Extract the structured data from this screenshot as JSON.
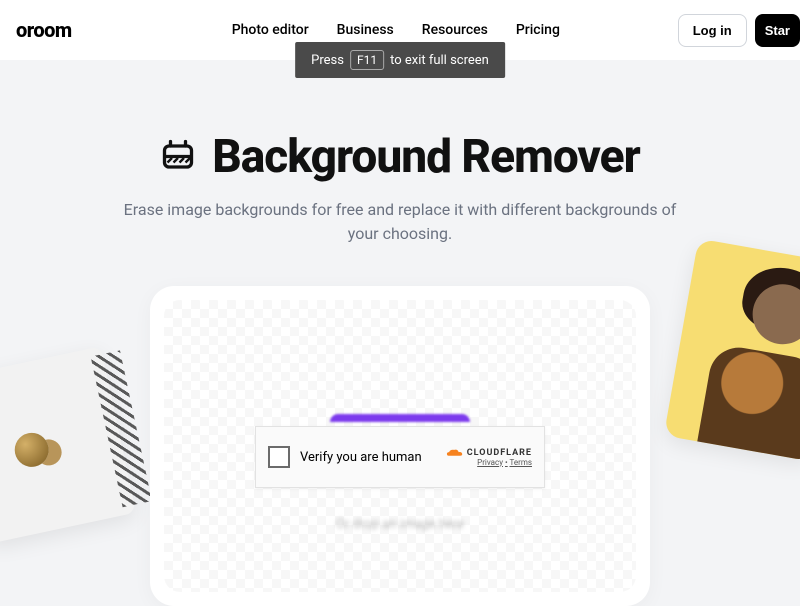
{
  "header": {
    "logo": "oroom",
    "nav": [
      "Photo editor",
      "Business",
      "Resources",
      "Pricing"
    ],
    "login": "Log in",
    "start": "Star"
  },
  "notice": {
    "pre": "Press",
    "key": "F11",
    "post": "to exit full screen"
  },
  "hero": {
    "title": "Background Remover",
    "subtitle": "Erase image backgrounds for free and replace it with different backgrounds of your choosing."
  },
  "upload": {
    "drop_hint": "Or drop an image here"
  },
  "captcha": {
    "label": "Verify you are human",
    "brand": "CLOUDFLARE",
    "privacy": "Privacy",
    "sep": "•",
    "terms": "Terms"
  }
}
